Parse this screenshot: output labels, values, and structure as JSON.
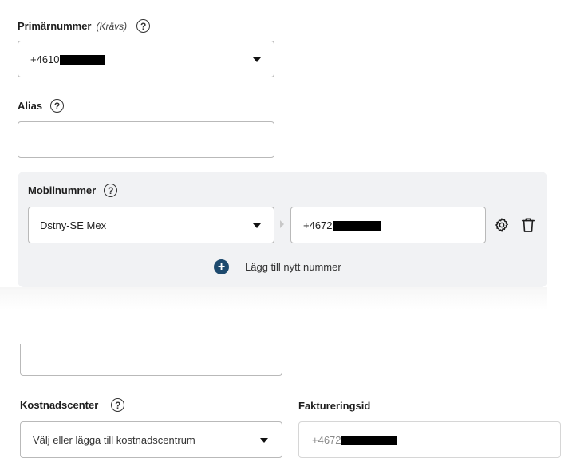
{
  "primary": {
    "label": "Primärnummer",
    "required": "(Krävs)",
    "value": "+4610"
  },
  "alias": {
    "label": "Alias",
    "value": ""
  },
  "mobile": {
    "label": "Mobilnummer",
    "operator": "Dstny-SE Mex",
    "number": "+4672",
    "add_label": "Lägg till nytt nummer"
  },
  "cost_center": {
    "label": "Kostnadscenter",
    "placeholder": "Välj eller lägga till kostnadscentrum"
  },
  "billing": {
    "label": "Faktureringsid",
    "value": "+4672"
  },
  "icons": {
    "help": "help-circle-icon",
    "dropdown": "chevron-down-icon",
    "settings": "gear-icon",
    "delete": "trash-icon",
    "add": "plus-circle-icon"
  },
  "colors": {
    "accent": "#1d4a6e",
    "panel": "#f1f2f4",
    "border": "#b9b9b9"
  }
}
